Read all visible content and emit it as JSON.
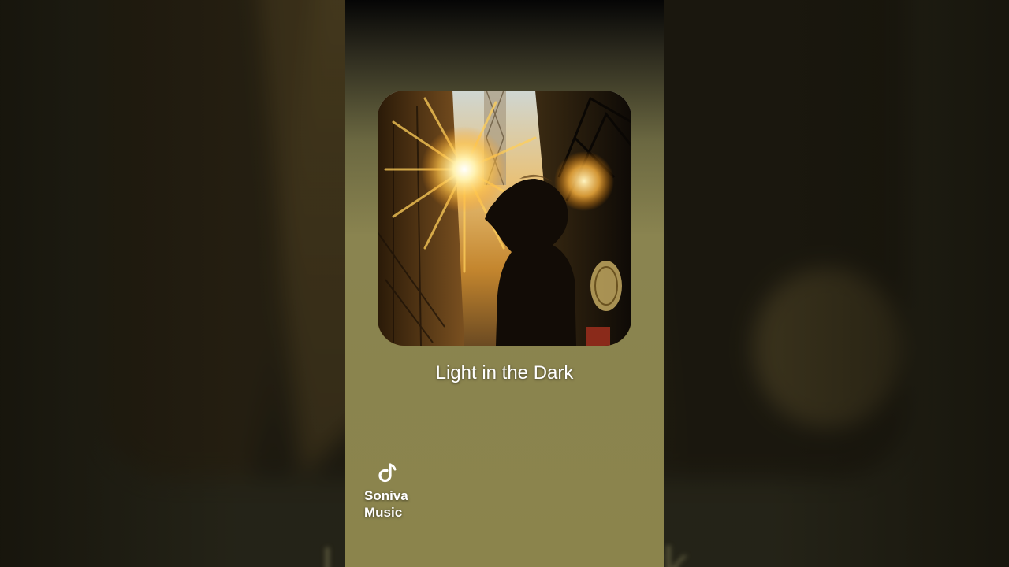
{
  "track": {
    "title": "Light in the Dark"
  },
  "brand": {
    "line1": "Soniva",
    "line2": "Music",
    "icon": "music-note-icon"
  },
  "background": {
    "title": "Light in the Dark"
  },
  "colors": {
    "panel_bottom": "#8b844c",
    "panel_top": "#050505",
    "sun": "#ffd35a",
    "text": "#ffffff"
  }
}
